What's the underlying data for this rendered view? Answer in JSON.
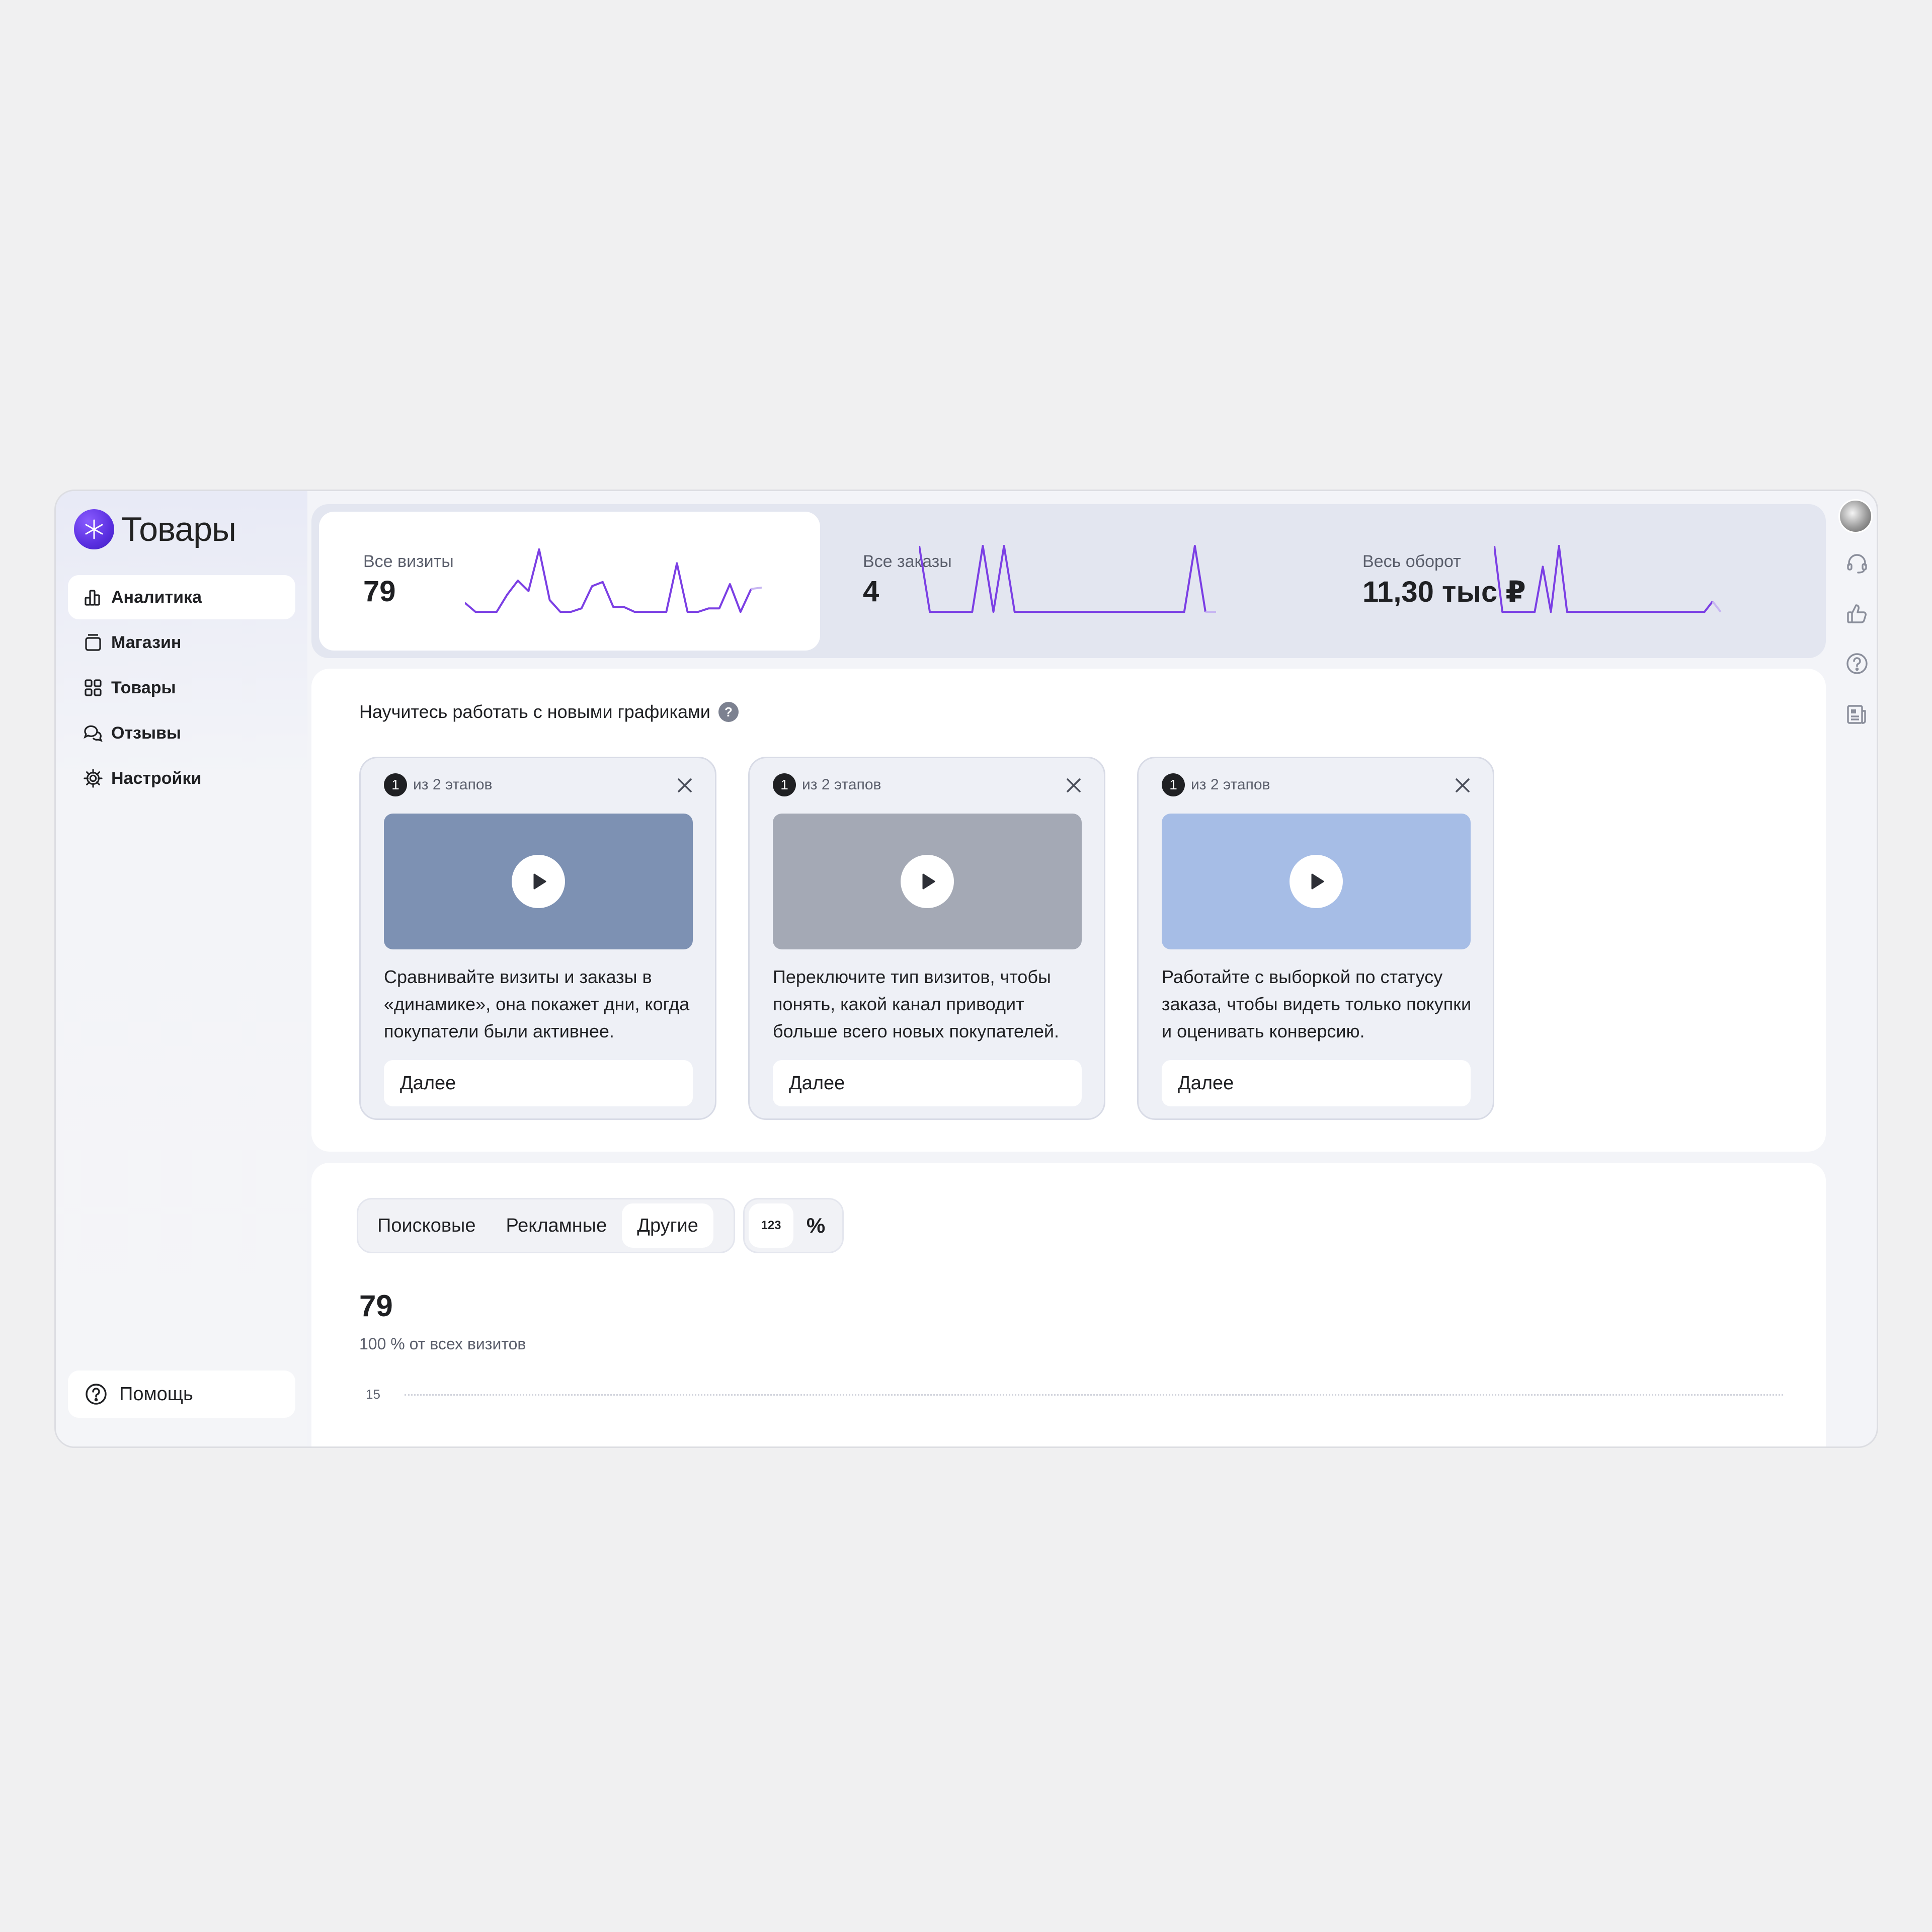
{
  "app": {
    "title": "Товары"
  },
  "sidebar": {
    "items": [
      {
        "label": "Аналитика",
        "icon": "bar-chart-icon",
        "active": true
      },
      {
        "label": "Магазин",
        "icon": "store-icon",
        "active": false
      },
      {
        "label": "Товары",
        "icon": "grid-icon",
        "active": false
      },
      {
        "label": "Отзывы",
        "icon": "chat-bubbles-icon",
        "active": false
      },
      {
        "label": "Настройки",
        "icon": "gear-icon",
        "active": false
      }
    ],
    "help_label": "Помощь"
  },
  "stats": [
    {
      "label": "Все визиты",
      "value": "79",
      "active": true
    },
    {
      "label": "Все заказы",
      "value": "4",
      "active": false
    },
    {
      "label": "Весь оборот",
      "value": "11,30 тыс ₽",
      "active": false
    }
  ],
  "sparklines": {
    "visits": [
      0.18,
      0.05,
      0.05,
      0.05,
      0.3,
      0.5,
      0.35,
      0.95,
      0.22,
      0.05,
      0.05,
      0.1,
      0.42,
      0.48,
      0.12,
      0.12,
      0.05,
      0.05,
      0.05,
      0.05,
      0.75,
      0.05,
      0.05,
      0.1,
      0.1,
      0.45,
      0.05,
      0.38,
      0.4
    ],
    "orders": [
      1,
      0.05,
      0.05,
      0.05,
      0.05,
      0.05,
      1,
      0.05,
      1,
      0.05,
      0.05,
      0.05,
      0.05,
      0.05,
      0.05,
      0.05,
      0.05,
      0.05,
      0.05,
      0.05,
      0.05,
      0.05,
      0.05,
      0.05,
      0.05,
      0.05,
      1,
      0.05,
      0.05
    ],
    "turnover": [
      1,
      0.05,
      0.05,
      0.05,
      0.05,
      0.05,
      0.7,
      0.05,
      1,
      0.05,
      0.05,
      0.05,
      0.05,
      0.05,
      0.05,
      0.05,
      0.05,
      0.05,
      0.05,
      0.05,
      0.05,
      0.05,
      0.05,
      0.05,
      0.05,
      0.05,
      0.05,
      0.2,
      0.05
    ]
  },
  "onboarding": {
    "title": "Научитесь работать с новыми графиками",
    "help_mark": "?",
    "cards": [
      {
        "step_num": "1",
        "step_text": "из 2 этапов",
        "video_color": "#7d91b3",
        "text": "Сравнивайте визиты и заказы в «динамике», она покажет дни, когда покупатели были активнее.",
        "button": "Далее"
      },
      {
        "step_num": "1",
        "step_text": "из 2 этапов",
        "video_color": "#a4a9b5",
        "text": "Переключите тип визитов, чтобы понять, какой канал приводит больше всего новых покупателей.",
        "button": "Далее"
      },
      {
        "step_num": "1",
        "step_text": "из 2 этапов",
        "video_color": "#a6bde6",
        "text": "Работайте с выборкой по статусу заказа, чтобы видеть только покупки и оценивать конверсию.",
        "button": "Далее"
      }
    ]
  },
  "visits_panel": {
    "tabs": [
      "Поисковые",
      "Рекламные",
      "Другие"
    ],
    "active_tab": 2,
    "units": [
      "123",
      "%"
    ],
    "active_unit": 0,
    "total": "79",
    "subtitle": "100 % от всех визитов",
    "y_tick": "15"
  },
  "colors": {
    "accent": "#7b3fe4",
    "brand": "#5a2fe0",
    "sparkline": "#7b3fe4"
  }
}
